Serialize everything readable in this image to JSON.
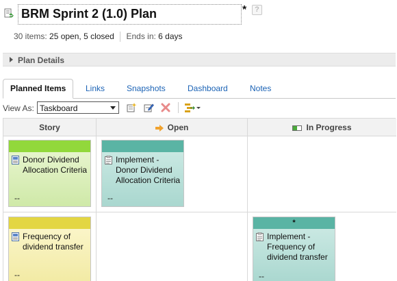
{
  "plan": {
    "title": "BRM Sprint 2 (1.0) Plan",
    "dirty_marker": "*",
    "help_glyph": "?",
    "summary": {
      "items_label": "30 items:",
      "status": "25 open, 5 closed",
      "ends_label": "Ends in:",
      "ends_value": "6 days"
    },
    "details_label": "Plan Details"
  },
  "tabs": [
    {
      "label": "Planned Items",
      "active": true
    },
    {
      "label": "Links"
    },
    {
      "label": "Snapshots"
    },
    {
      "label": "Dashboard"
    },
    {
      "label": "Notes"
    }
  ],
  "toolbar": {
    "view_as_label": "View As:",
    "view_as_value": "Taskboard"
  },
  "board": {
    "columns": [
      {
        "title": "Story",
        "icon": "none"
      },
      {
        "title": "Open",
        "icon": "right-arrow-icon"
      },
      {
        "title": "In Progress",
        "icon": "progress-bar-icon"
      }
    ],
    "cards": [
      {
        "column": "Story",
        "label": "Donor Dividend Allocation Criteria",
        "estimate": "--",
        "type_icon": "story-icon",
        "color": "#92d83b",
        "body_color": "#d9efb6",
        "marker": ""
      },
      {
        "column": "Open",
        "label": "Implement - Donor Dividend Allocation Criteria",
        "estimate": "--",
        "type_icon": "task-icon",
        "color": "#5ab4a4",
        "body_color": "#b7dfd9",
        "marker": ""
      },
      {
        "column": "Story",
        "label": "Frequency of dividend transfer",
        "estimate": "--",
        "type_icon": "story-icon",
        "color": "#e3d643",
        "body_color": "#f6f0b2",
        "marker": ""
      },
      {
        "column": "In Progress",
        "label": "Implement - Frequency of dividend transfer",
        "estimate": "--",
        "type_icon": "task-icon",
        "color": "#5ab4a4",
        "body_color": "#b7dfd9",
        "marker": "*"
      }
    ]
  }
}
